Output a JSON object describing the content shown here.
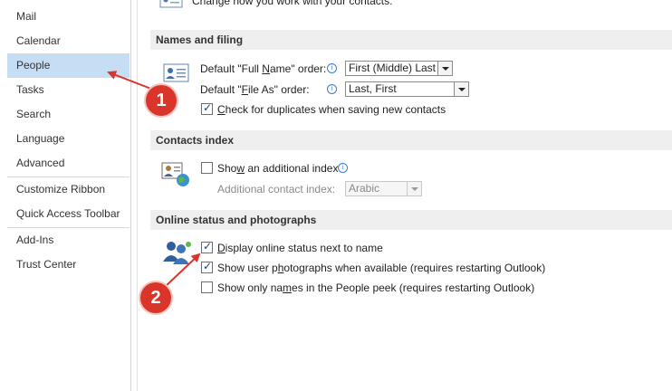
{
  "sidebar": {
    "items": [
      "Mail",
      "Calendar",
      "People",
      "Tasks",
      "Search",
      "Language",
      "Advanced",
      "Customize Ribbon",
      "Quick Access Toolbar",
      "Add-Ins",
      "Trust Center"
    ],
    "selected": "People",
    "selected_color": "#c5def4"
  },
  "top": {
    "text": "Change how you work with your contacts."
  },
  "names_filing": {
    "header": "Names and filing",
    "full_name_label_pre": "Default \"Full ",
    "full_name_label_u": "N",
    "full_name_label_post": "ame\" order:",
    "full_name_value": "First (Middle) Last",
    "file_as_label_pre": "Default \"",
    "file_as_label_u": "F",
    "file_as_label_post": "ile As\" order:",
    "file_as_value": "Last, First",
    "duplicates_u": "C",
    "duplicates_post": "heck for duplicates when saving new contacts",
    "duplicates_checked": true
  },
  "contacts_index": {
    "header": "Contacts index",
    "show_index_pre": "Sho",
    "show_index_u": "w",
    "show_index_post": " an additional index",
    "show_index_checked": false,
    "additional_label": "Additional contact index:",
    "additional_value": "Arabic"
  },
  "online_status": {
    "header": "Online status and photographs",
    "display_u": "D",
    "display_post": "isplay online status next to name",
    "display_checked": true,
    "photos_pre": "Show user p",
    "photos_u": "h",
    "photos_post": "otographs when available (requires restarting Outlook)",
    "photos_checked": true,
    "names_pre": "Show only na",
    "names_u": "m",
    "names_post": "es in the People peek (requires restarting Outlook)",
    "names_checked": false
  },
  "annotations": {
    "badge1": "1",
    "badge2": "2",
    "color": "#d9352b"
  },
  "icons": [
    "contact-card-icon",
    "contacts-index-icon",
    "people-online-icon",
    "info-icon",
    "dropdown-arrow-icon"
  ]
}
